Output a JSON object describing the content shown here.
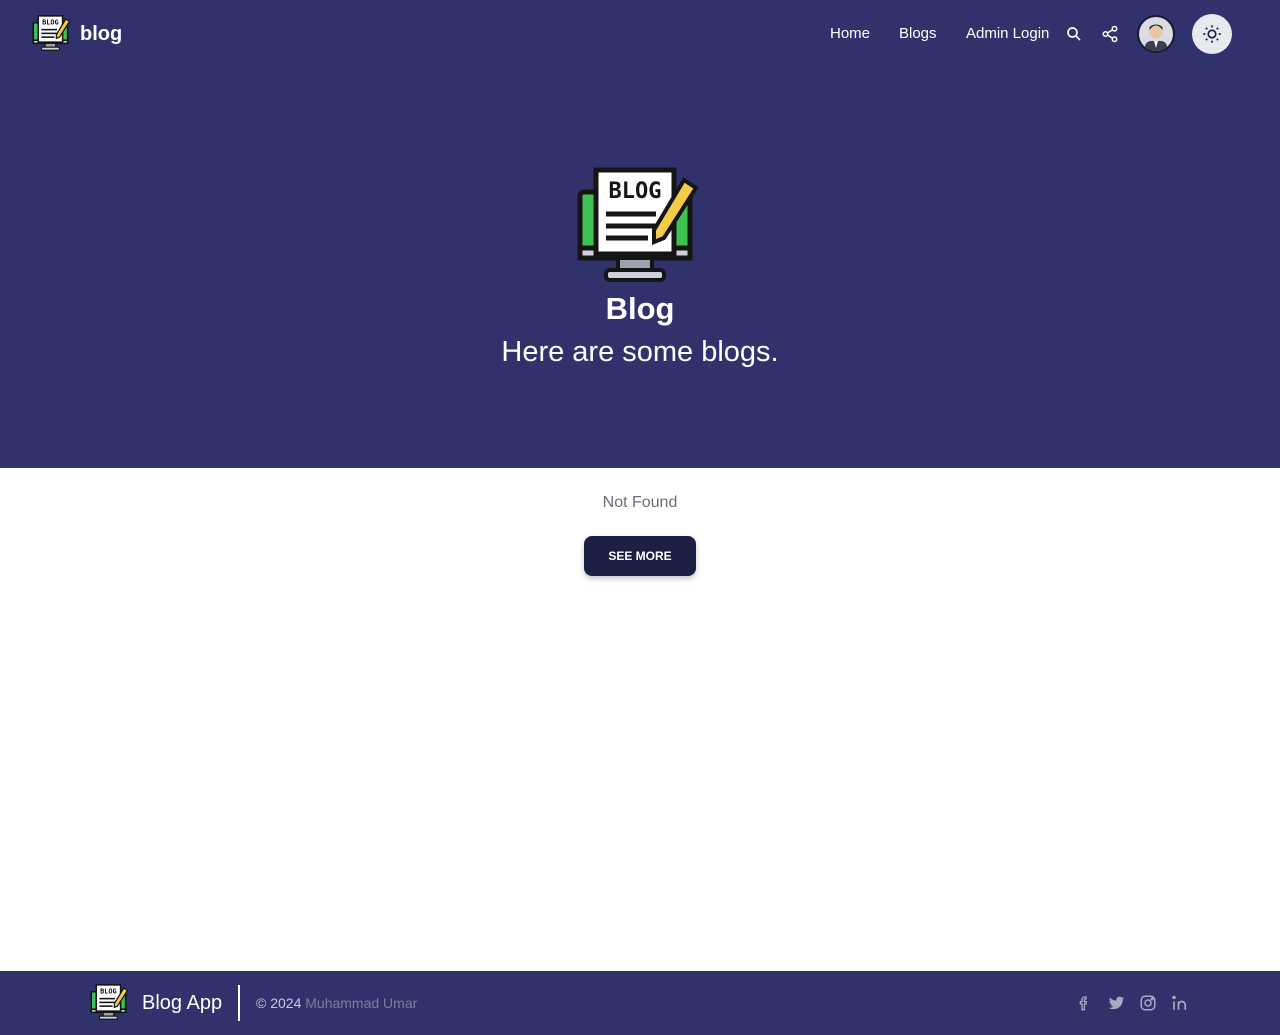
{
  "header": {
    "brand": "blog",
    "logo_icon": "blog-monitor-icon",
    "nav": {
      "home": "Home",
      "blogs": "Blogs",
      "admin_login": "Admin Login"
    },
    "icons": [
      "search-icon",
      "share-icon",
      "avatar",
      "sun-icon"
    ]
  },
  "hero": {
    "logo_icon": "blog-monitor-icon",
    "logo_text": "BLOG",
    "title": "Blog",
    "subtitle": "Here are some blogs."
  },
  "content": {
    "status": "Not Found",
    "see_more": "SEE MORE"
  },
  "footer": {
    "brand": "Blog App",
    "copyright": "© 2024",
    "author": "Muhammad Umar",
    "social_icons": [
      "facebook-icon",
      "twitter-icon",
      "instagram-icon",
      "linkedin-icon"
    ]
  },
  "colors": {
    "primary": "#31326b",
    "button": "#1d1f45",
    "muted_text": "#6b6e78",
    "author_text": "#7c7e96"
  }
}
